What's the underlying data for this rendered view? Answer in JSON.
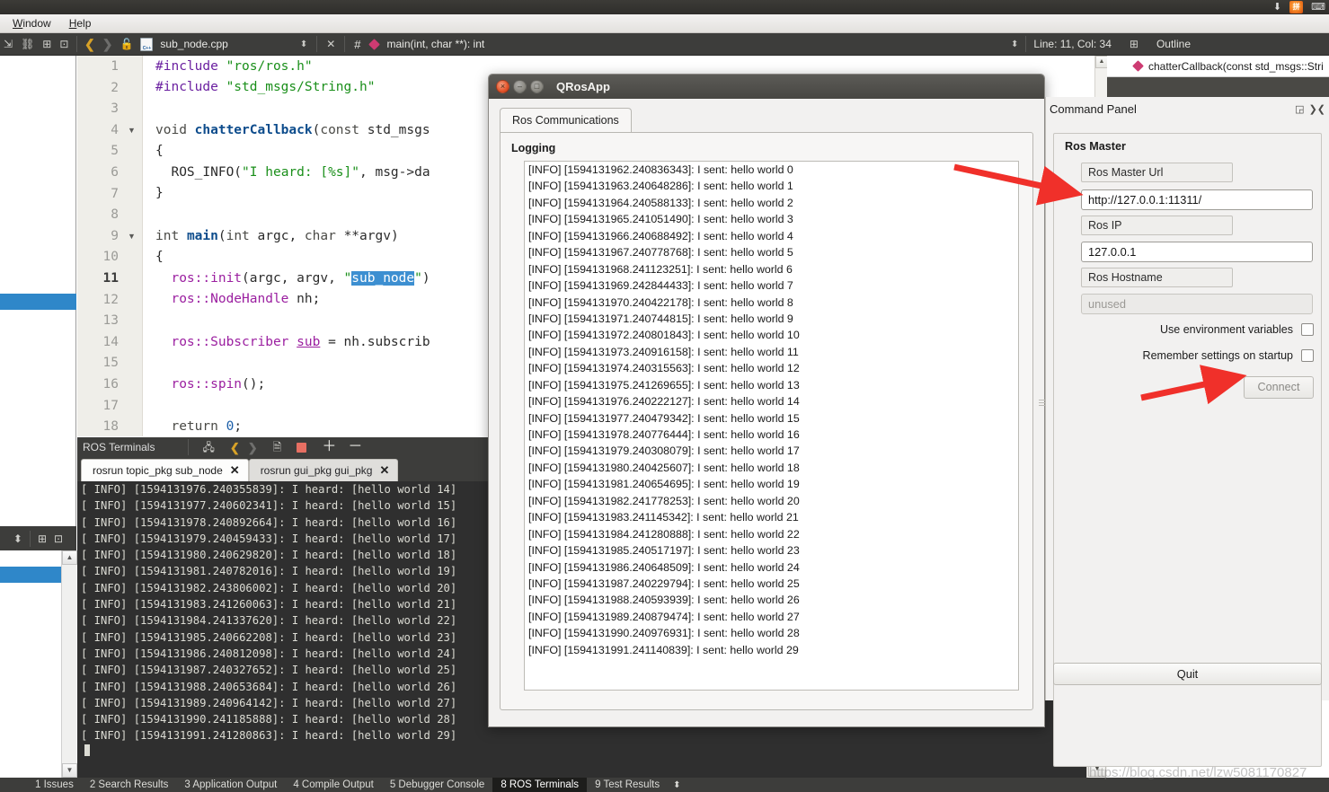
{
  "desktop": {
    "tray": {
      "download_icon": "download-arrow",
      "ime_icon": "拼",
      "keyboard_icon": "keyboard"
    }
  },
  "ide": {
    "menus": [
      {
        "label": "Window",
        "mnemonic": "W"
      },
      {
        "label": "Help",
        "mnemonic": "H"
      }
    ],
    "editor_toolbar": {
      "filename": "sub_node.cpp",
      "symbol": "main(int, char **): int",
      "line_col": "Line: 11, Col: 34",
      "outline_label": "Outline"
    },
    "outline": {
      "entry": "chatterCallback(const std_msgs::Stri"
    },
    "code_lines": [
      {
        "n": "1",
        "fold": false,
        "html": "<span class=\"pre\">#include</span> <span class=\"str\">\"ros/ros.h\"</span>"
      },
      {
        "n": "2",
        "fold": false,
        "html": "<span class=\"pre\">#include</span> <span class=\"str\">\"std_msgs/String.h\"</span>"
      },
      {
        "n": "3",
        "fold": false,
        "html": ""
      },
      {
        "n": "4",
        "fold": true,
        "html": "<span class=\"kw2\">void</span> <span class=\"fn\">chatterCallback</span><span class=\"pl\">(</span><span class=\"kw2\">const</span> <span class=\"pl\">std_msgs</span>"
      },
      {
        "n": "5",
        "fold": false,
        "html": "<span class=\"pl\">{</span>"
      },
      {
        "n": "6",
        "fold": false,
        "html": "  <span class=\"pl\">ROS_INFO(</span><span class=\"str\">\"I heard: [%s]\"</span><span class=\"pl\">, msg-&gt;da</span>"
      },
      {
        "n": "7",
        "fold": false,
        "html": "<span class=\"pl\">}</span>"
      },
      {
        "n": "8",
        "fold": false,
        "html": ""
      },
      {
        "n": "9",
        "fold": true,
        "html": "<span class=\"kw2\">int</span> <span class=\"fn\">main</span><span class=\"pl\">(</span><span class=\"kw2\">int</span> <span class=\"pl\">argc, </span><span class=\"kw2\">char</span> <span class=\"pl\">**argv)</span>"
      },
      {
        "n": "10",
        "fold": false,
        "html": "<span class=\"pl\">{</span>"
      },
      {
        "n": "11",
        "fold": false,
        "cur": true,
        "html": "  <span class=\"purple\">ros::init</span><span class=\"pl\">(argc, argv, </span><span class=\"str\">\"</span><span class=\"sel\">sub_node</span><span class=\"str\">\"</span><span class=\"pl\">)</span>"
      },
      {
        "n": "12",
        "fold": false,
        "html": "  <span class=\"purple\">ros::NodeHandle</span> <span class=\"pl\">nh;</span>"
      },
      {
        "n": "13",
        "fold": false,
        "html": ""
      },
      {
        "n": "14",
        "fold": false,
        "html": "  <span class=\"purple\">ros::Subscriber</span> <span class=\"underl\">sub</span> <span class=\"pl\">= nh.subscrib</span>"
      },
      {
        "n": "15",
        "fold": false,
        "html": ""
      },
      {
        "n": "16",
        "fold": false,
        "html": "  <span class=\"purple\">ros::spin</span><span class=\"pl\">();</span>"
      },
      {
        "n": "17",
        "fold": false,
        "html": ""
      },
      {
        "n": "18",
        "fold": false,
        "html": "  <span class=\"kw2\">return</span> <span class=\"num\">0</span><span class=\"pl\">;</span>"
      }
    ],
    "ros_terminals": {
      "title": "ROS Terminals",
      "tabs": [
        {
          "label": "rosrun topic_pkg sub_node",
          "active": true
        },
        {
          "label": "rosrun gui_pkg gui_pkg",
          "active": false
        }
      ],
      "lines": [
        "[ INFO] [1594131976.240355839]: I heard: [hello world 14]",
        "[ INFO] [1594131977.240602341]: I heard: [hello world 15]",
        "[ INFO] [1594131978.240892664]: I heard: [hello world 16]",
        "[ INFO] [1594131979.240459433]: I heard: [hello world 17]",
        "[ INFO] [1594131980.240629820]: I heard: [hello world 18]",
        "[ INFO] [1594131981.240782016]: I heard: [hello world 19]",
        "[ INFO] [1594131982.243806002]: I heard: [hello world 20]",
        "[ INFO] [1594131983.241260063]: I heard: [hello world 21]",
        "[ INFO] [1594131984.241337620]: I heard: [hello world 22]",
        "[ INFO] [1594131985.240662208]: I heard: [hello world 23]",
        "[ INFO] [1594131986.240812098]: I heard: [hello world 24]",
        "[ INFO] [1594131987.240327652]: I heard: [hello world 25]",
        "[ INFO] [1594131988.240653684]: I heard: [hello world 26]",
        "[ INFO] [1594131989.240964142]: I heard: [hello world 27]",
        "[ INFO] [1594131990.241185888]: I heard: [hello world 28]",
        "[ INFO] [1594131991.241280863]: I heard: [hello world 29]"
      ]
    },
    "statusbar": [
      {
        "num": "1",
        "label": "Issues",
        "active": false
      },
      {
        "num": "2",
        "label": "Search Results",
        "active": false
      },
      {
        "num": "3",
        "label": "Application Output",
        "active": false
      },
      {
        "num": "4",
        "label": "Compile Output",
        "active": false
      },
      {
        "num": "5",
        "label": "Debugger Console",
        "active": false
      },
      {
        "num": "8",
        "label": "ROS Terminals",
        "active": true
      },
      {
        "num": "9",
        "label": "Test Results",
        "active": false
      }
    ]
  },
  "qrosapp": {
    "title": "QRosApp",
    "window_buttons": {
      "close": "×",
      "minimize": "–",
      "maximize": "□"
    },
    "tab": "Ros Communications",
    "logging_label": "Logging",
    "log_lines": [
      "[INFO] [1594131962.240836343]: I sent: hello world 0",
      "[INFO] [1594131963.240648286]: I sent: hello world 1",
      "[INFO] [1594131964.240588133]: I sent: hello world 2",
      "[INFO] [1594131965.241051490]: I sent: hello world 3",
      "[INFO] [1594131966.240688492]: I sent: hello world 4",
      "[INFO] [1594131967.240778768]: I sent: hello world 5",
      "[INFO] [1594131968.241123251]: I sent: hello world 6",
      "[INFO] [1594131969.242844433]: I sent: hello world 7",
      "[INFO] [1594131970.240422178]: I sent: hello world 8",
      "[INFO] [1594131971.240744815]: I sent: hello world 9",
      "[INFO] [1594131972.240801843]: I sent: hello world 10",
      "[INFO] [1594131973.240916158]: I sent: hello world 11",
      "[INFO] [1594131974.240315563]: I sent: hello world 12",
      "[INFO] [1594131975.241269655]: I sent: hello world 13",
      "[INFO] [1594131976.240222127]: I sent: hello world 14",
      "[INFO] [1594131977.240479342]: I sent: hello world 15",
      "[INFO] [1594131978.240776444]: I sent: hello world 16",
      "[INFO] [1594131979.240308079]: I sent: hello world 17",
      "[INFO] [1594131980.240425607]: I sent: hello world 18",
      "[INFO] [1594131981.240654695]: I sent: hello world 19",
      "[INFO] [1594131982.241778253]: I sent: hello world 20",
      "[INFO] [1594131983.241145342]: I sent: hello world 21",
      "[INFO] [1594131984.241280888]: I sent: hello world 22",
      "[INFO] [1594131985.240517197]: I sent: hello world 23",
      "[INFO] [1594131986.240648509]: I sent: hello world 24",
      "[INFO] [1594131987.240229794]: I sent: hello world 25",
      "[INFO] [1594131988.240593939]: I sent: hello world 26",
      "[INFO] [1594131989.240879474]: I sent: hello world 27",
      "[INFO] [1594131990.240976931]: I sent: hello world 28",
      "[INFO] [1594131991.241140839]: I sent: hello world 29"
    ]
  },
  "command_panel": {
    "title": "Command Panel",
    "group_title": "Ros Master",
    "master_url_label": "Ros Master Url",
    "master_url_value": "http://127.0.0.1:11311/",
    "ros_ip_label": "Ros IP",
    "ros_ip_value": "127.0.0.1",
    "ros_hostname_label": "Ros Hostname",
    "ros_hostname_value": "unused",
    "use_env_label": "Use environment variables",
    "remember_label": "Remember settings on startup",
    "connect_label": "Connect",
    "quit_label": "Quit"
  },
  "annotations": {
    "arrow_color": "#f0302a",
    "arrow_to_url_field": "points at Ros Master Url input",
    "arrow_to_connect": "points at Connect button"
  },
  "watermark": "https://blog.csdn.net/lzw5081170827"
}
